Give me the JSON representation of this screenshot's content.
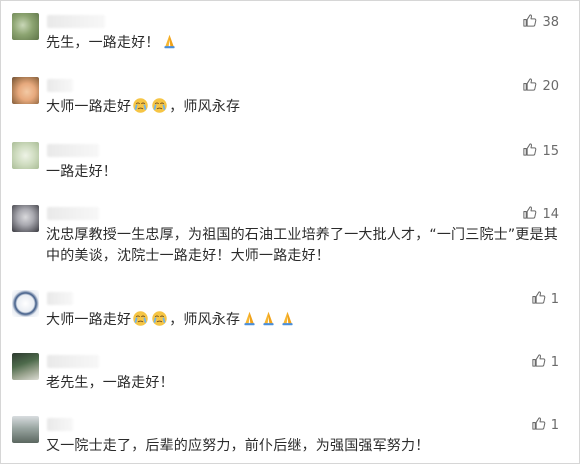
{
  "comments": [
    {
      "text": "先生，一路走好！",
      "emojis": [
        "pray"
      ],
      "likes": "38"
    },
    {
      "text_a": "大师一路走好",
      "emojis_mid": [
        "cry",
        "cry"
      ],
      "text_b": "，师风永存",
      "likes": "20"
    },
    {
      "text": "一路走好！",
      "likes": "15"
    },
    {
      "text": "沈忠厚教授一生忠厚，为祖国的石油工业培养了一大批人才，“一门三院士”更是其中的美谈，沈院士一路走好！大师一路走好！",
      "likes": "14"
    },
    {
      "text_a": "大师一路走好",
      "emojis_mid": [
        "cry",
        "cry"
      ],
      "text_b": "，师风永存",
      "emojis_end": [
        "pray",
        "pray",
        "pray"
      ],
      "likes": "1"
    },
    {
      "text": "老先生，一路走好！",
      "likes": "1"
    },
    {
      "text": "又一院士走了，后辈的应努力，前仆后继，为强国强军努力！",
      "likes": "1"
    }
  ],
  "icons": {
    "like": "thumbs-up-icon",
    "pray": "pray-emoji-icon",
    "cry": "crying-emoji-icon"
  }
}
